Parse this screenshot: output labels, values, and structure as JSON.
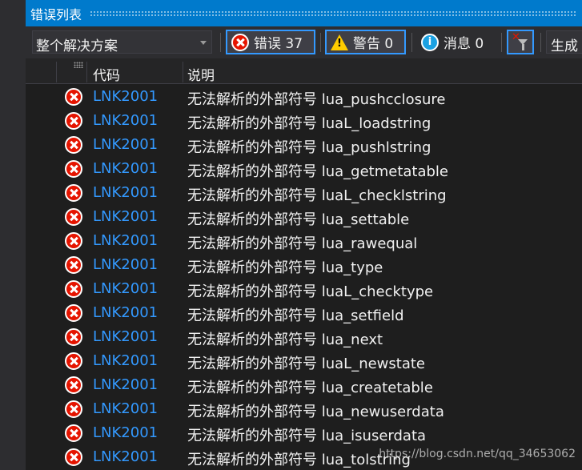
{
  "window": {
    "title": "错误列表"
  },
  "toolbar": {
    "scope": "整个解决方案",
    "errors_label": "错误 37",
    "warnings_label": "警告 0",
    "messages_label": "消息 0",
    "build_label": "生成"
  },
  "columns": {
    "code": "代码",
    "description": "说明"
  },
  "rows": [
    {
      "code": "LNK2001",
      "desc": "无法解析的外部符号 lua_pushcclosure"
    },
    {
      "code": "LNK2001",
      "desc": "无法解析的外部符号 luaL_loadstring"
    },
    {
      "code": "LNK2001",
      "desc": "无法解析的外部符号 lua_pushlstring"
    },
    {
      "code": "LNK2001",
      "desc": "无法解析的外部符号 lua_getmetatable"
    },
    {
      "code": "LNK2001",
      "desc": "无法解析的外部符号 luaL_checklstring"
    },
    {
      "code": "LNK2001",
      "desc": "无法解析的外部符号 lua_settable"
    },
    {
      "code": "LNK2001",
      "desc": "无法解析的外部符号 lua_rawequal"
    },
    {
      "code": "LNK2001",
      "desc": "无法解析的外部符号 lua_type"
    },
    {
      "code": "LNK2001",
      "desc": "无法解析的外部符号 luaL_checktype"
    },
    {
      "code": "LNK2001",
      "desc": "无法解析的外部符号 lua_setfield"
    },
    {
      "code": "LNK2001",
      "desc": "无法解析的外部符号 lua_next"
    },
    {
      "code": "LNK2001",
      "desc": "无法解析的外部符号 luaL_newstate"
    },
    {
      "code": "LNK2001",
      "desc": "无法解析的外部符号 lua_createtable"
    },
    {
      "code": "LNK2001",
      "desc": "无法解析的外部符号 lua_newuserdata"
    },
    {
      "code": "LNK2001",
      "desc": "无法解析的外部符号 lua_isuserdata"
    },
    {
      "code": "LNK2001",
      "desc": "无法解析的外部符号 lua_tolstring"
    }
  ],
  "watermark": "https://blog.csdn.net/qq_34653062",
  "colors": {
    "accent": "#007acc",
    "error": "#e51400",
    "code_link": "#3399ff",
    "warning": "#ffcc00",
    "info": "#1ba1e2"
  },
  "icons": {
    "error": "error-icon",
    "warning": "warning-icon",
    "info": "info-icon",
    "filter": "clear-filter-icon"
  }
}
